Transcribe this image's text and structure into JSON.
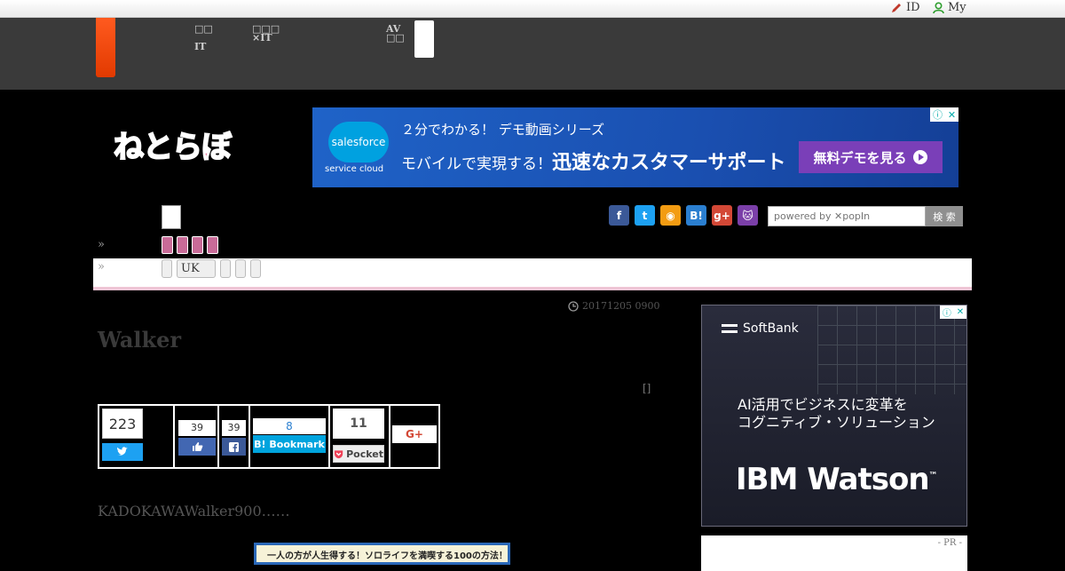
{
  "topbar": {
    "id_label": "ID",
    "my_label": "My"
  },
  "header": {
    "nav": [
      {
        "line1": "□□",
        "line2": "IT"
      },
      {
        "line1": "□□□",
        "line2": "×IT"
      },
      {
        "line1": "AV",
        "line2": "□□"
      }
    ]
  },
  "logo": {
    "text": "ねとらぼ"
  },
  "ad_top": {
    "brand": "salesforce",
    "sub": "service cloud",
    "line1": "２分でわかる！ デモ動画シリーズ",
    "line2_a": "モバイルで実現する！",
    "line2_b": "迅速なカスタマーサポート",
    "cta": "無料デモを見る",
    "cta_icon": "play-icon",
    "info_icon": "ⓘ",
    "close_icon": "✕"
  },
  "social": {
    "icons": [
      {
        "name": "facebook-icon",
        "glyph": "f",
        "color": "#3b5998"
      },
      {
        "name": "twitter-icon",
        "glyph": "t",
        "color": "#1da1f2"
      },
      {
        "name": "rss-icon",
        "glyph": "◉",
        "color": "#f39c12"
      },
      {
        "name": "hatena-icon",
        "glyph": "B!",
        "color": "#2b7fd0"
      },
      {
        "name": "googleplus-icon",
        "glyph": "g+",
        "color": "#d34836"
      },
      {
        "name": "cat-icon",
        "glyph": "🐱",
        "color": "#7b3fa8"
      }
    ]
  },
  "search": {
    "placeholder": "powered by ✕popIn",
    "button": "検 索"
  },
  "breadcrumb": {
    "sep": "»"
  },
  "tabs": [
    "",
    "UK",
    "",
    "",
    ""
  ],
  "article": {
    "date": "20171205 0900",
    "date_icon": "clock-icon",
    "title": "Walker",
    "bracket": "[]",
    "lead": "KADOKAWAWalker900……",
    "book_caption": "一人の方が人生得する！ソロライフを満喫する100の方法！"
  },
  "share": {
    "twitter_count": "223",
    "like_count": "39",
    "fb_count": "39",
    "hatena_count": "8",
    "hatena_label": "B! Bookmark",
    "pocket_count": "11",
    "pocket_label": "Pocket",
    "gplus_label": "G+"
  },
  "ad_side": {
    "brand": "SoftBank",
    "line1": "AI活用でビジネスに変革を",
    "line2": "コグニティブ・ソリューション",
    "product": "IBM Watson",
    "product_mark": "™",
    "info_icon": "ⓘ",
    "close_icon": "✕"
  },
  "pr": {
    "label": "- PR -"
  }
}
